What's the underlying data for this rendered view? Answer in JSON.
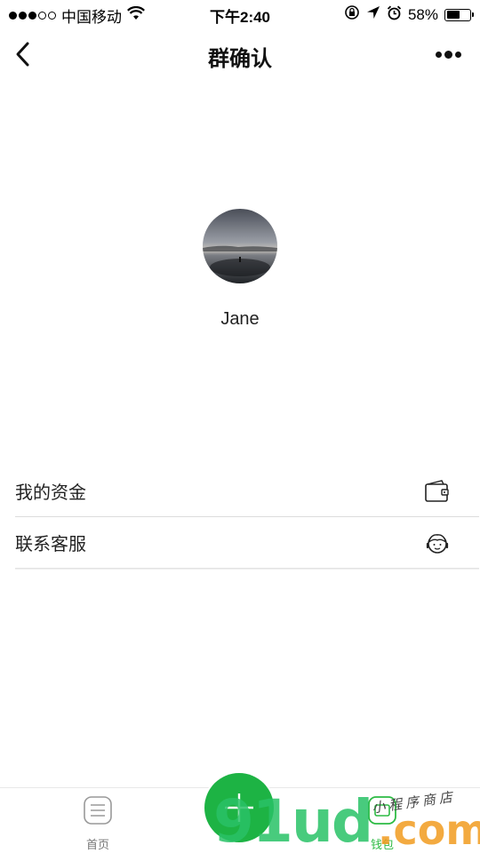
{
  "status_bar": {
    "carrier": "中国移动",
    "time": "下午2:40",
    "battery_percent": "58%",
    "battery_level": 0.58,
    "signal_icons": [
      "signal-dot",
      "signal-dot",
      "signal-dot",
      "signal-dot-empty",
      "signal-dot-empty"
    ]
  },
  "nav": {
    "title": "群确认",
    "back_icon": "chevron-left-icon",
    "more_icon": "more-dots-icon"
  },
  "profile": {
    "name": "Jane"
  },
  "menu": {
    "items": [
      {
        "label": "我的资金",
        "icon": "wallet-icon"
      },
      {
        "label": "联系客服",
        "icon": "customer-service-icon"
      }
    ]
  },
  "tab_bar": {
    "tabs": [
      {
        "label": "首页",
        "icon": "list-icon"
      },
      {
        "label": "钱包",
        "icon": "wallet-tab-icon"
      }
    ],
    "center_button_icon": "plus-icon",
    "accent_color": "#1db344"
  },
  "watermark": {
    "main": "91ud",
    "suffix": ".com",
    "handwritten": "小程序商店"
  }
}
